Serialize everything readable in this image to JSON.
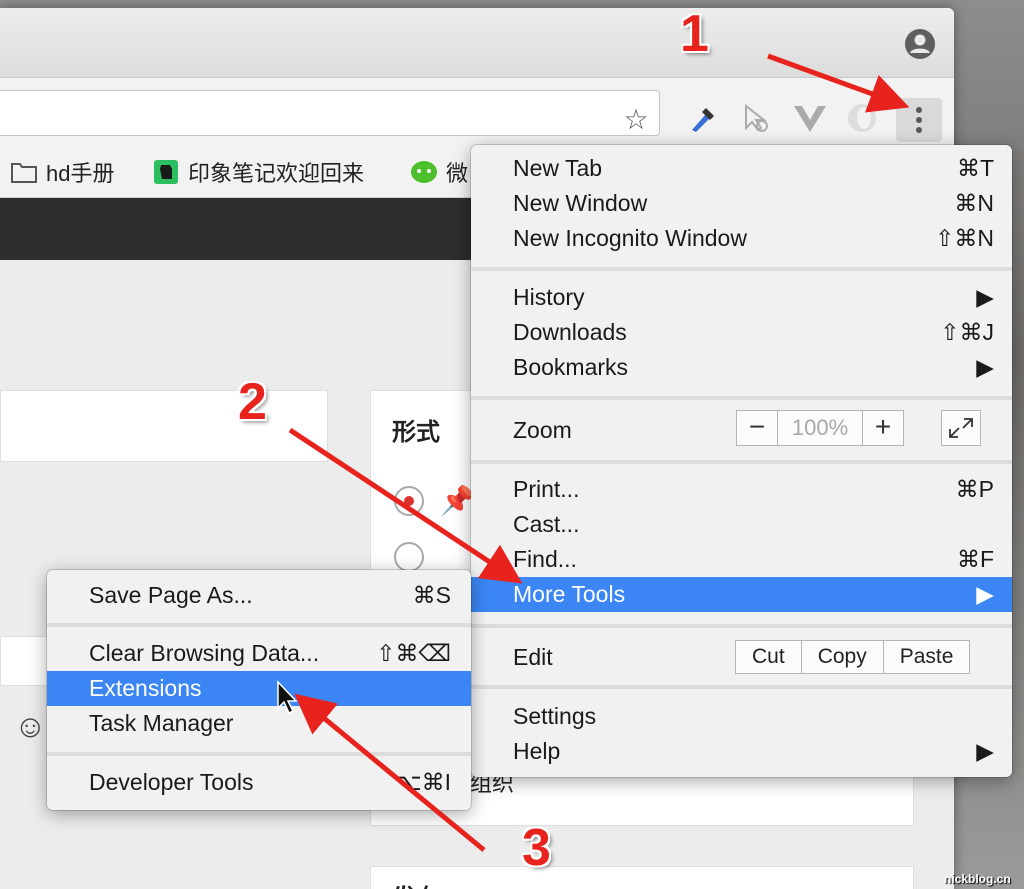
{
  "bookmarks": [
    {
      "label": "hd手册",
      "icon": "folder-icon"
    },
    {
      "label": "印象笔记欢迎回来",
      "icon": "evernote-icon"
    },
    {
      "label": "微",
      "icon": "wechat-icon"
    }
  ],
  "page": {
    "section_label": "形式",
    "section_label_2": "发布",
    "partial_text": "组织"
  },
  "main_menu": {
    "items": [
      {
        "label": "New Tab",
        "shortcut": "⌘T"
      },
      {
        "label": "New Window",
        "shortcut": "⌘N"
      },
      {
        "label": "New Incognito Window",
        "shortcut": "⇧⌘N"
      },
      {
        "label": "History",
        "shortcut": "▶"
      },
      {
        "label": "Downloads",
        "shortcut": "⇧⌘J"
      },
      {
        "label": "Bookmarks",
        "shortcut": "▶"
      },
      {
        "label": "Zoom",
        "shortcut": ""
      },
      {
        "label": "Print...",
        "shortcut": "⌘P"
      },
      {
        "label": "Cast...",
        "shortcut": ""
      },
      {
        "label": "Find...",
        "shortcut": "⌘F"
      },
      {
        "label": "More Tools",
        "shortcut": "▶"
      },
      {
        "label": "Edit",
        "shortcut": ""
      },
      {
        "label": "Settings",
        "shortcut": ""
      },
      {
        "label": "Help",
        "shortcut": "▶"
      }
    ],
    "zoom": {
      "minus": "−",
      "value": "100%",
      "plus": "+"
    },
    "edit": {
      "cut": "Cut",
      "copy": "Copy",
      "paste": "Paste"
    }
  },
  "sub_menu": {
    "items": [
      {
        "label": "Save Page As...",
        "shortcut": "⌘S"
      },
      {
        "label": "Clear Browsing Data...",
        "shortcut": "⇧⌘⌫"
      },
      {
        "label": "Extensions",
        "shortcut": ""
      },
      {
        "label": "Task Manager",
        "shortcut": ""
      },
      {
        "label": "Developer Tools",
        "shortcut": "⌥⌘I"
      }
    ]
  },
  "annotations": {
    "step1": "1",
    "step2": "2",
    "step3": "3"
  },
  "watermark": "nickblog.cn",
  "colors": {
    "highlight": "#3b86f4",
    "annotation": "#e8221c"
  }
}
